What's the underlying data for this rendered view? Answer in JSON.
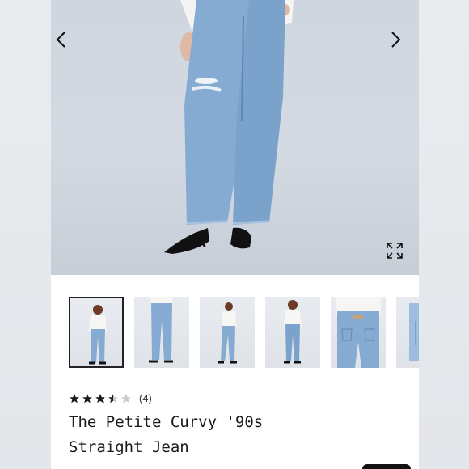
{
  "product": {
    "title_line1": "The Petite Curvy '90s",
    "title_line2": "Straight Jean",
    "rating": 3.5,
    "rating_max": 5,
    "review_count": "(4)"
  },
  "gallery": {
    "prev_icon": "chevron-left-icon",
    "next_icon": "chevron-right-icon",
    "expand_icon": "expand-icon",
    "thumbnail_count_visible": 6,
    "selected_thumbnail": 0
  },
  "colors": {
    "star_filled": "#1a1a1a",
    "star_empty": "#c9c9c9",
    "denim": "#7fa6cf",
    "selected_border": "#222222"
  }
}
